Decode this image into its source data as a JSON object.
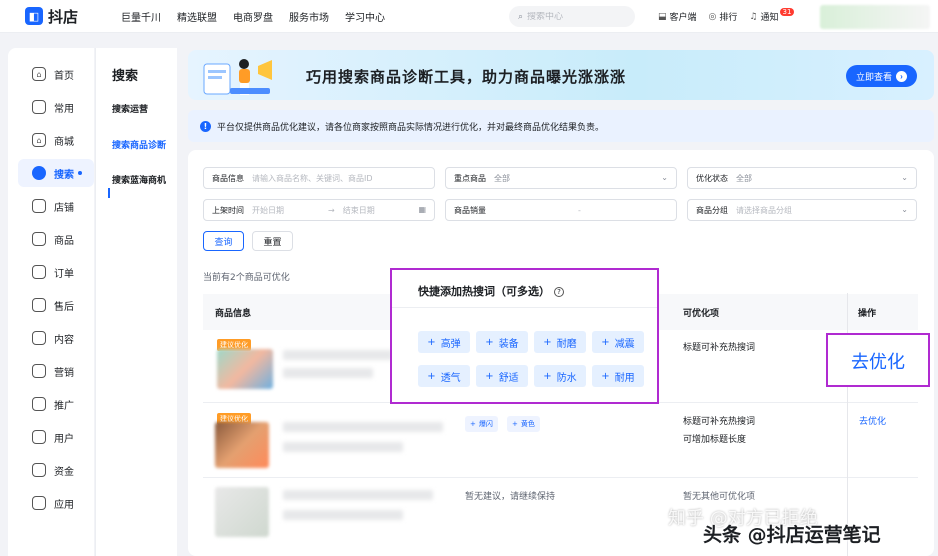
{
  "topbar": {
    "logo_text": "抖店",
    "nav": [
      "巨量千川",
      "精选联盟",
      "电商罗盘",
      "服务市场",
      "学习中心"
    ],
    "search_placeholder": "搜索中心",
    "actions": {
      "client": "客户端",
      "rank": "排行",
      "notify": "通知",
      "notify_count": "31"
    }
  },
  "sidebar": {
    "items": [
      {
        "label": "首页",
        "icon": "home-icon",
        "active": false
      },
      {
        "label": "常用",
        "icon": "folder-icon",
        "active": false
      },
      {
        "label": "商城",
        "icon": "mall-icon",
        "active": false
      },
      {
        "label": "搜索",
        "icon": "search-icon",
        "active": true
      },
      {
        "label": "店铺",
        "icon": "store-icon",
        "active": false
      },
      {
        "label": "商品",
        "icon": "goods-icon",
        "active": false
      },
      {
        "label": "订单",
        "icon": "order-icon",
        "active": false
      },
      {
        "label": "售后",
        "icon": "aftersale-icon",
        "active": false
      },
      {
        "label": "内容",
        "icon": "content-icon",
        "active": false
      },
      {
        "label": "营销",
        "icon": "megaphone-icon",
        "active": false
      },
      {
        "label": "推广",
        "icon": "promote-icon",
        "active": false
      },
      {
        "label": "用户",
        "icon": "user-icon",
        "active": false
      },
      {
        "label": "资金",
        "icon": "wallet-icon",
        "active": false
      },
      {
        "label": "应用",
        "icon": "app-icon",
        "active": false
      }
    ]
  },
  "submenu": {
    "title": "搜索",
    "items": [
      "搜索运营",
      "搜索商品诊断",
      "搜索蓝海商机"
    ],
    "active_index": 1
  },
  "banner": {
    "title": "巧用搜索商品诊断工具，助力商品曝光涨涨涨",
    "button": "立即查看"
  },
  "notice": {
    "text": "平台仅提供商品优化建议，请各位商家按照商品实际情况进行优化，并对最终商品优化结果负责。"
  },
  "filters": {
    "product_info": {
      "label": "商品信息",
      "placeholder": "请输入商品名称、关键词、商品ID"
    },
    "key_product": {
      "label": "重点商品",
      "value": "全部"
    },
    "opt_status": {
      "label": "优化状态",
      "value": "全部"
    },
    "listing_time": {
      "label": "上架时间",
      "start": "开始日期",
      "end": "结束日期"
    },
    "sales": {
      "label": "商品销量"
    },
    "category": {
      "label": "商品分组",
      "placeholder": "请选择商品分组"
    },
    "query": "查询",
    "reset": "重置"
  },
  "summary": "当前有2个商品可优化",
  "table": {
    "headers": {
      "info": "商品信息",
      "optimizable": "可优化项",
      "action": "操作"
    },
    "rows": [
      {
        "tag": "建议优化",
        "opt": [
          "标题可补充热搜词"
        ],
        "action": "去优化"
      },
      {
        "tag": "建议优化",
        "keywords": [
          "爆闪",
          "黄色"
        ],
        "opt": [
          "标题可补充热搜词",
          "可增加标题长度"
        ],
        "action": "去优化"
      },
      {
        "suggestion": "暂无建议，请继续保持",
        "opt": [
          "暂无其他可优化项"
        ]
      }
    ]
  },
  "popover": {
    "title": "快捷添加热搜词（可多选）",
    "keywords": [
      "高弹",
      "装备",
      "耐磨",
      "减震",
      "透气",
      "舒适",
      "防水",
      "耐用"
    ]
  },
  "highlight_action": "去优化",
  "watermark": {
    "zhihu": "知乎 @对方已拒绝",
    "toutiao": "头条 @抖店运营笔记"
  },
  "colors": {
    "brand": "#1966ff",
    "annotation": "#b02ad1",
    "tag": "#ff9c26"
  }
}
